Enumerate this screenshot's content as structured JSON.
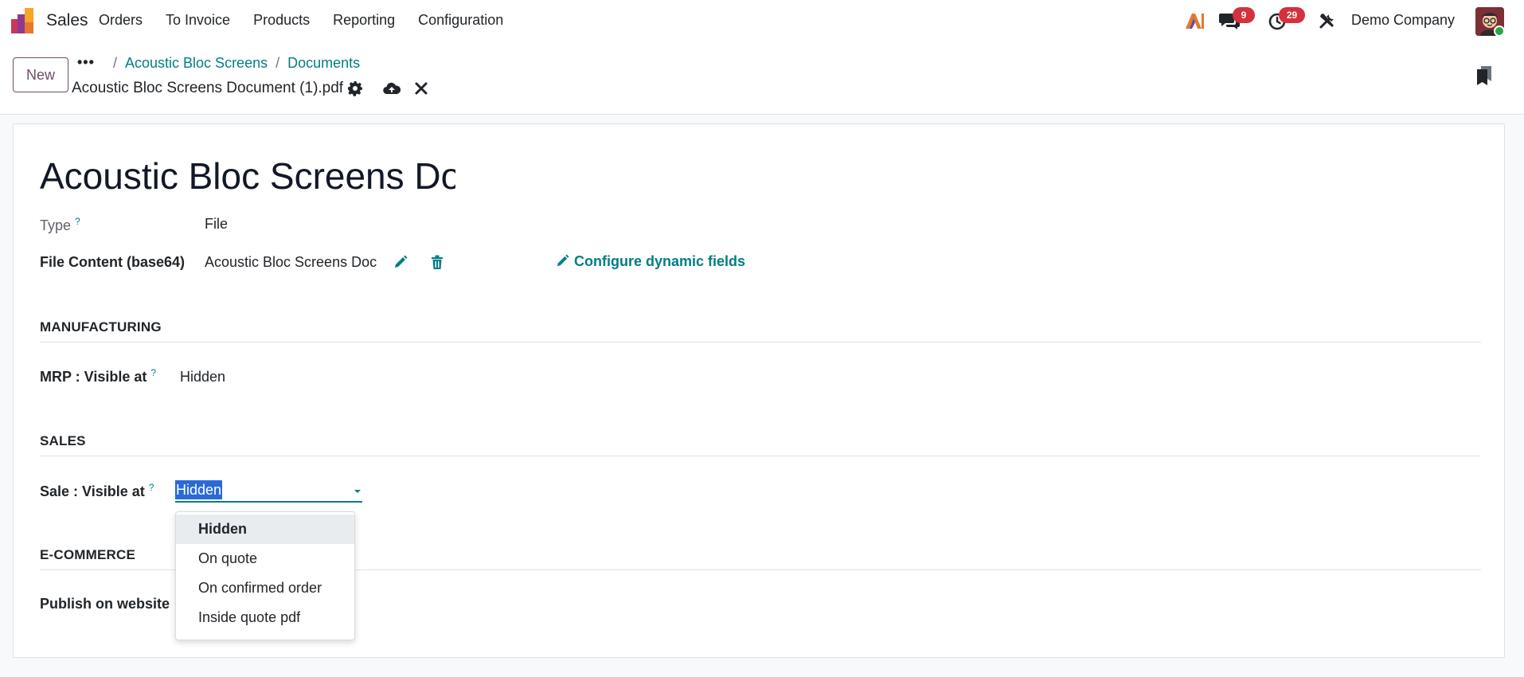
{
  "navbar": {
    "app_name": "Sales",
    "menu": [
      "Orders",
      "To Invoice",
      "Products",
      "Reporting",
      "Configuration"
    ],
    "messages_count": "9",
    "activities_count": "29",
    "company": "Demo Company",
    "badge_color": "#d6303d"
  },
  "control": {
    "new_label": "New",
    "more_label": "•••",
    "breadcrumbs": [
      "Acoustic Bloc Screens",
      "Documents"
    ],
    "record_name": "Acoustic Bloc Screens Document (1).pdf"
  },
  "form": {
    "title": "Acoustic Bloc Screens Doc",
    "type_label": "Type",
    "type_help": "?",
    "type_value": "File",
    "file_content_label": "File Content (base64)",
    "file_content_value": "Acoustic Bloc Screens Doc",
    "configure_label": "Configure dynamic fields",
    "sections": {
      "manufacturing": {
        "title": "MANUFACTURING",
        "field_label": "MRP : Visible at",
        "field_help": "?",
        "field_value": "Hidden"
      },
      "sales": {
        "title": "SALES",
        "field_label": "Sale : Visible at",
        "field_help": "?",
        "field_value": "Hidden"
      },
      "ecommerce": {
        "title": "E-COMMERCE",
        "field_label": "Publish on website"
      }
    }
  },
  "dropdown": {
    "options": [
      "Hidden",
      "On quote",
      "On confirmed order",
      "Inside quote pdf"
    ],
    "active": "Hidden"
  },
  "colors": {
    "accent": "#017e84",
    "brand": "#714b67",
    "selection": "#2a6ad6"
  }
}
